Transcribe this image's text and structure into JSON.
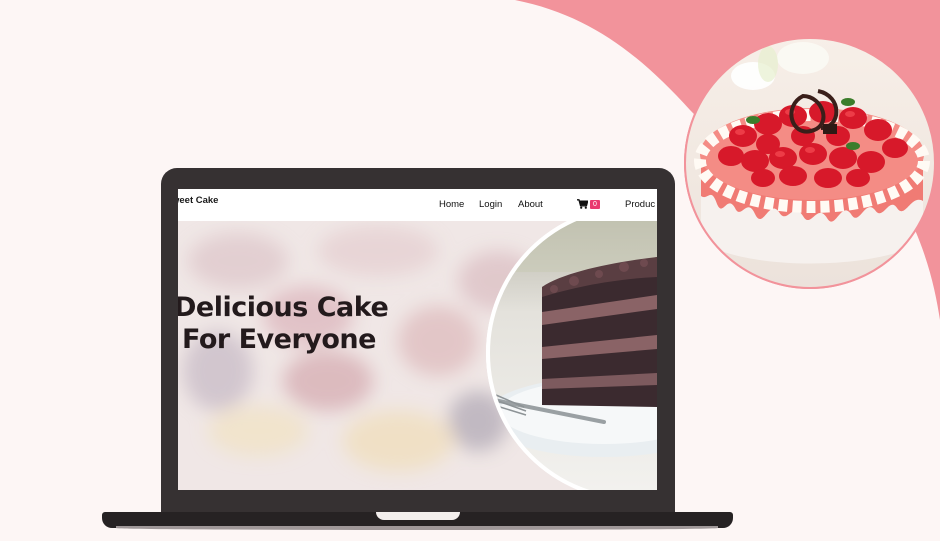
{
  "site": {
    "brand": "weet Cake",
    "nav": {
      "home": "Home",
      "login": "Login",
      "about": "About",
      "cart_count": "0",
      "products": "Produc"
    },
    "hero": {
      "line1": "Delicious Cake",
      "line2": "For Everyone"
    }
  },
  "icons": {
    "cart": "shopping-cart-icon"
  },
  "colors": {
    "background": "#fdf6f5",
    "accent_pink": "#f2939b",
    "cart_badge": "#e93a6f",
    "laptop_frame": "#363132",
    "heading_text": "#231a1c"
  }
}
